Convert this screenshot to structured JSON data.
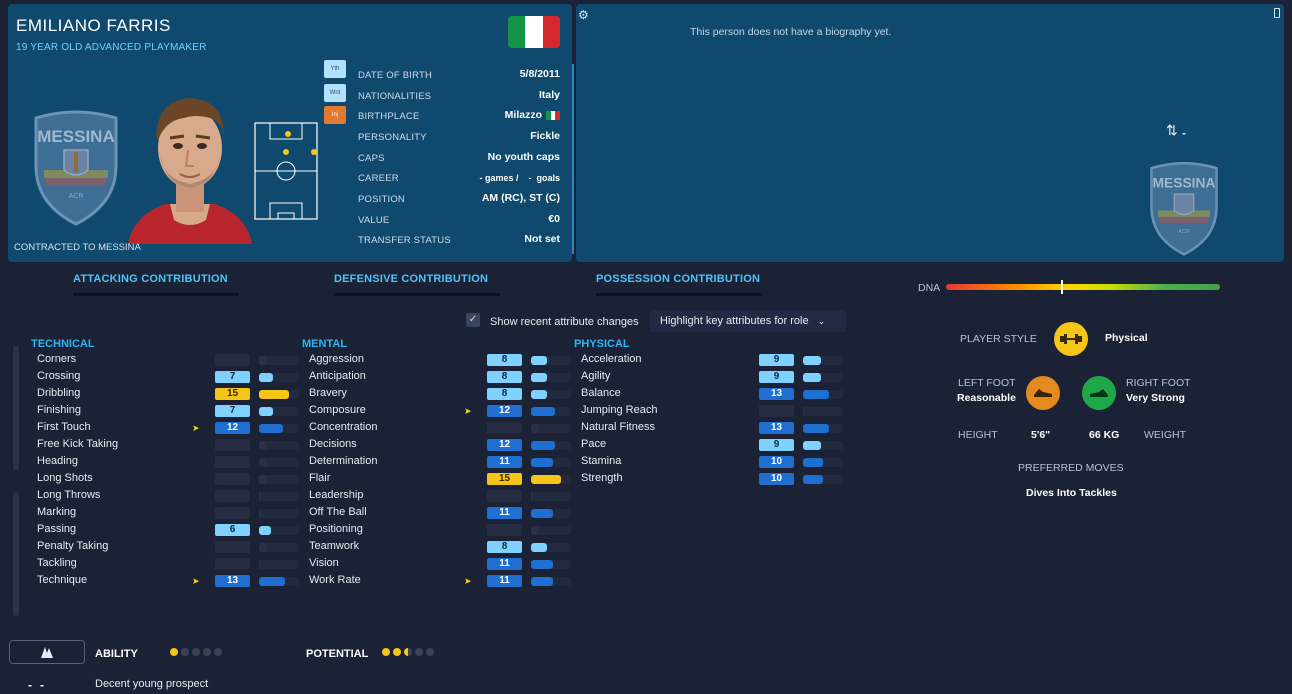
{
  "player": {
    "name": "EMILIANO FARRIS",
    "subtitle": "19 YEAR OLD ADVANCED PLAYMAKER",
    "contracted": "CONTRACTED TO MESSINA",
    "club_name": "MESSINA",
    "club_sub": "ACR"
  },
  "badges": {
    "yth": "Yth",
    "wnt": "Wnt",
    "inj": "Inj"
  },
  "info": [
    {
      "label": "DATE OF BIRTH",
      "value": "5/8/2011"
    },
    {
      "label": "NATIONALITIES",
      "value": "Italy"
    },
    {
      "label": "BIRTHPLACE",
      "value": "Milazzo"
    },
    {
      "label": "PERSONALITY",
      "value": "Fickle"
    },
    {
      "label": "CAPS",
      "value": "No youth caps"
    },
    {
      "label": "CAREER",
      "value": "- games /    -  goals"
    },
    {
      "label": "POSITION",
      "value": "AM (RC), ST (C)"
    },
    {
      "label": "VALUE",
      "value": "€0"
    },
    {
      "label": "TRANSFER STATUS",
      "value": "Not set"
    }
  ],
  "bio": {
    "text": "This person does not have a biography yet.",
    "rating_symbol": "-"
  },
  "contribution": {
    "attacking": "ATTACKING CONTRIBUTION",
    "defensive": "DEFENSIVE CONTRIBUTION",
    "possession": "POSSESSION CONTRIBUTION"
  },
  "controls": {
    "show_recent": "Show recent attribute changes",
    "highlight": "Highlight key attributes for role",
    "dna_label": "DNA",
    "dna_marker_fraction": 0.42
  },
  "colors": {
    "header_bg": "#0f4a6e",
    "page_bg": "#1c2236",
    "accent": "#29b6f6",
    "highlight_yellow": "#f5c518",
    "attr_blue_dark": "#1e6fd0",
    "attr_blue_light": "#7fd1ff"
  },
  "technical": {
    "title": "TECHNICAL",
    "items": [
      {
        "name": "Corners",
        "value": "",
        "level": 0.2,
        "kind": "dim",
        "arrow": false
      },
      {
        "name": "Crossing",
        "value": "7",
        "level": 0.35,
        "kind": "light",
        "arrow": false
      },
      {
        "name": "Dribbling",
        "value": "15",
        "level": 0.75,
        "kind": "yellow",
        "arrow": false
      },
      {
        "name": "Finishing",
        "value": "7",
        "level": 0.35,
        "kind": "light",
        "arrow": false
      },
      {
        "name": "First Touch",
        "value": "12",
        "level": 0.6,
        "kind": "dark",
        "arrow": true
      },
      {
        "name": "Free Kick Taking",
        "value": "",
        "level": 0.2,
        "kind": "dim",
        "arrow": false
      },
      {
        "name": "Heading",
        "value": "",
        "level": 0.2,
        "kind": "dim",
        "arrow": false
      },
      {
        "name": "Long Shots",
        "value": "",
        "level": 0.2,
        "kind": "dim",
        "arrow": false
      },
      {
        "name": "Long Throws",
        "value": "",
        "level": 0.05,
        "kind": "dim",
        "arrow": false
      },
      {
        "name": "Marking",
        "value": "",
        "level": 0.05,
        "kind": "dim",
        "arrow": false
      },
      {
        "name": "Passing",
        "value": "6",
        "level": 0.3,
        "kind": "light",
        "arrow": false
      },
      {
        "name": "Penalty Taking",
        "value": "",
        "level": 0.2,
        "kind": "dim",
        "arrow": false
      },
      {
        "name": "Tackling",
        "value": "",
        "level": 0.05,
        "kind": "dim",
        "arrow": false
      },
      {
        "name": "Technique",
        "value": "13",
        "level": 0.65,
        "kind": "dark",
        "arrow": true
      }
    ]
  },
  "mental": {
    "title": "MENTAL",
    "items": [
      {
        "name": "Aggression",
        "value": "8",
        "level": 0.4,
        "kind": "light",
        "arrow": false
      },
      {
        "name": "Anticipation",
        "value": "8",
        "level": 0.4,
        "kind": "light",
        "arrow": false
      },
      {
        "name": "Bravery",
        "value": "8",
        "level": 0.4,
        "kind": "light",
        "arrow": false
      },
      {
        "name": "Composure",
        "value": "12",
        "level": 0.6,
        "kind": "dark",
        "arrow": true
      },
      {
        "name": "Concentration",
        "value": "",
        "level": 0.2,
        "kind": "dim",
        "arrow": false
      },
      {
        "name": "Decisions",
        "value": "12",
        "level": 0.6,
        "kind": "dark",
        "arrow": false
      },
      {
        "name": "Determination",
        "value": "11",
        "level": 0.55,
        "kind": "dark",
        "arrow": false
      },
      {
        "name": "Flair",
        "value": "15",
        "level": 0.75,
        "kind": "yellow",
        "arrow": false
      },
      {
        "name": "Leadership",
        "value": "",
        "level": 0.05,
        "kind": "dim",
        "arrow": false
      },
      {
        "name": "Off The Ball",
        "value": "11",
        "level": 0.55,
        "kind": "dark",
        "arrow": false
      },
      {
        "name": "Positioning",
        "value": "",
        "level": 0.2,
        "kind": "dim",
        "arrow": false
      },
      {
        "name": "Teamwork",
        "value": "8",
        "level": 0.4,
        "kind": "light",
        "arrow": false
      },
      {
        "name": "Vision",
        "value": "11",
        "level": 0.55,
        "kind": "dark",
        "arrow": false
      },
      {
        "name": "Work Rate",
        "value": "11",
        "level": 0.55,
        "kind": "dark",
        "arrow": true
      }
    ]
  },
  "physical": {
    "title": "PHYSICAL",
    "items": [
      {
        "name": "Acceleration",
        "value": "9",
        "level": 0.45,
        "kind": "light",
        "arrow": false
      },
      {
        "name": "Agility",
        "value": "9",
        "level": 0.45,
        "kind": "light",
        "arrow": false
      },
      {
        "name": "Balance",
        "value": "13",
        "level": 0.65,
        "kind": "dark",
        "arrow": false
      },
      {
        "name": "Jumping Reach",
        "value": "",
        "level": 0.05,
        "kind": "dim",
        "arrow": false
      },
      {
        "name": "Natural Fitness",
        "value": "13",
        "level": 0.65,
        "kind": "dark",
        "arrow": false
      },
      {
        "name": "Pace",
        "value": "9",
        "level": 0.45,
        "kind": "light",
        "arrow": false
      },
      {
        "name": "Stamina",
        "value": "10",
        "level": 0.5,
        "kind": "dark",
        "arrow": false
      },
      {
        "name": "Strength",
        "value": "10",
        "level": 0.5,
        "kind": "dark",
        "arrow": false
      }
    ]
  },
  "profile": {
    "player_style_label": "PLAYER STYLE",
    "player_style_value": "Physical",
    "left_foot_label": "LEFT FOOT",
    "left_foot_value": "Reasonable",
    "right_foot_label": "RIGHT FOOT",
    "right_foot_value": "Very Strong",
    "height_label": "HEIGHT",
    "height_value": "5'6\"",
    "weight_value": "66 KG",
    "weight_label": "WEIGHT",
    "preferred_moves_label": "PREFERRED MOVES",
    "preferred_moves_value": "Dives Into Tackles"
  },
  "footer": {
    "ability_label": "ABILITY",
    "potential_label": "POTENTIAL",
    "ability_stars": 1,
    "potential_stars": 2.5,
    "dash": "-",
    "scout_comment": "Decent young prospect"
  }
}
